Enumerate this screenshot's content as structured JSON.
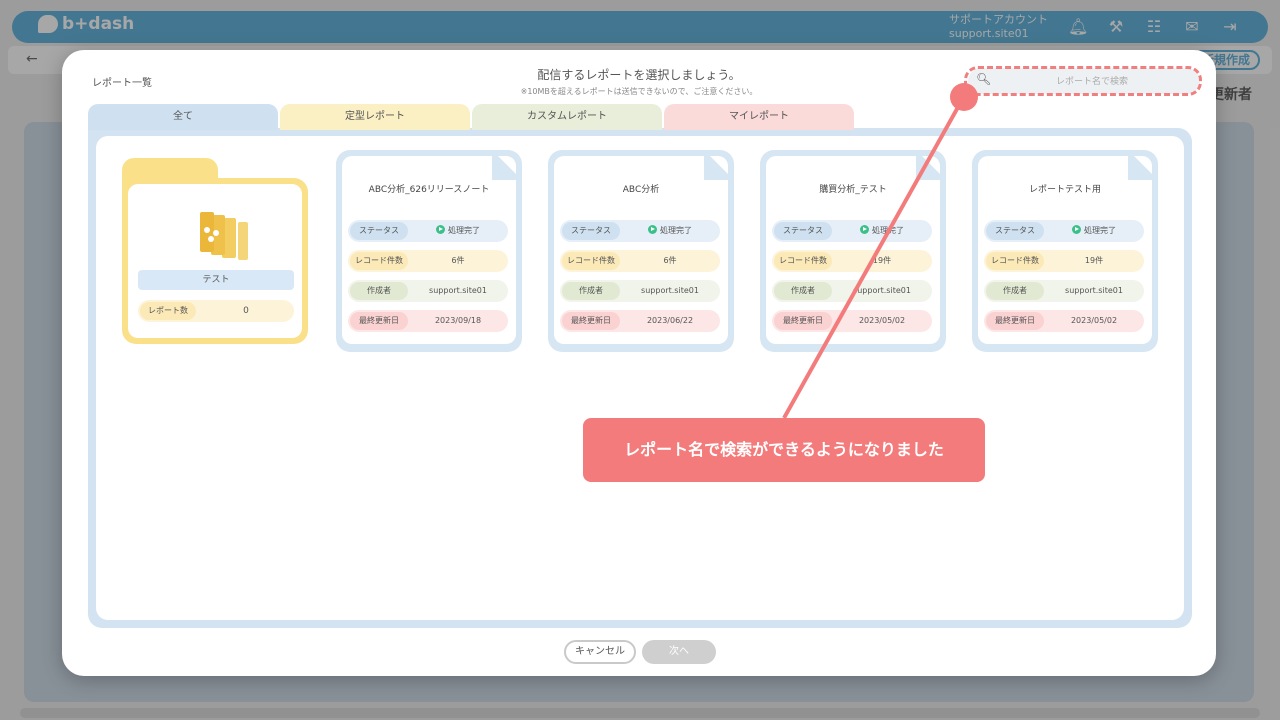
{
  "app": {
    "logo": "b+dash",
    "account_label": "サポートアカウント",
    "account_id": "support.site01",
    "new_button": "新規作成",
    "updated_column": "更新者",
    "top_icons": [
      "bell-icon",
      "wrench-icon",
      "grid-icon",
      "chat-icon",
      "logout-icon"
    ]
  },
  "modal": {
    "title": "レポート一覧",
    "heading": "配信するレポートを選択しましょう。",
    "subheading": "※10MBを超えるレポートは送信できないので、ご注意ください。",
    "search_placeholder": "レポート名で検索",
    "tabs": [
      {
        "label": "全て"
      },
      {
        "label": "定型レポート"
      },
      {
        "label": "カスタムレポート"
      },
      {
        "label": "マイレポート"
      }
    ],
    "folder": {
      "name": "テスト",
      "count_label": "レポート数",
      "count_value": "0"
    },
    "field_labels": {
      "status": "ステータス",
      "records": "レコード件数",
      "author": "作成者",
      "updated": "最終更新日"
    },
    "reports": [
      {
        "title": "ABC分析_626リリースノート",
        "status": "処理完了",
        "records": "6件",
        "author": "support.site01",
        "updated": "2023/09/18"
      },
      {
        "title": "ABC分析",
        "status": "処理完了",
        "records": "6件",
        "author": "support.site01",
        "updated": "2023/06/22"
      },
      {
        "title": "購買分析_テスト",
        "status": "処理完了",
        "records": "19件",
        "author": "support.site01",
        "updated": "2023/05/02"
      },
      {
        "title": "レポートテスト用",
        "status": "処理完了",
        "records": "19件",
        "author": "support.site01",
        "updated": "2023/05/02"
      }
    ],
    "cancel_button": "キャンセル",
    "next_button": "次へ"
  },
  "annotation": {
    "callout_text": "レポート名で検索ができるようになりました",
    "color": "#f47b7b"
  }
}
